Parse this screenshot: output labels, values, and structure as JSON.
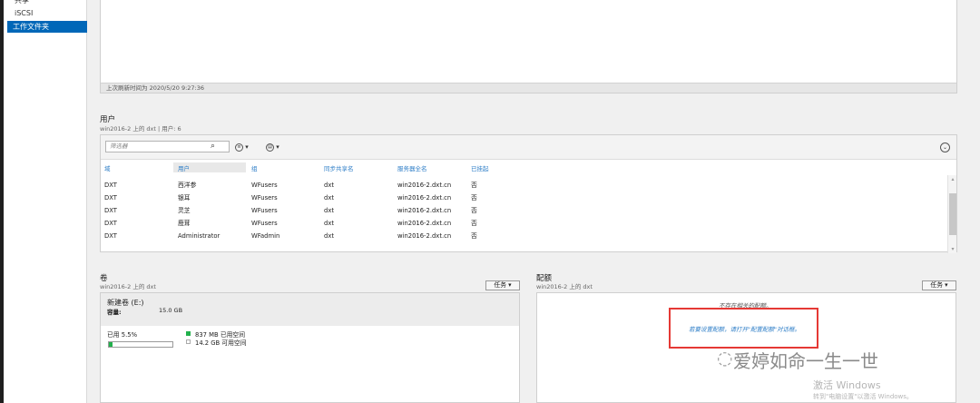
{
  "nav": {
    "items": [
      {
        "label": "共享"
      },
      {
        "label": "iSCSI"
      },
      {
        "label": "工作文件夹"
      }
    ]
  },
  "top_panel": {
    "last_refresh": "上次刷新时间为 2020/5/20 9:27:36"
  },
  "users": {
    "title": "用户",
    "subtitle": "win2016-2 上的 dxt | 用户: 6",
    "filter_placeholder": "筛选器",
    "columns": [
      "域",
      "用户",
      "组",
      "同步共享名",
      "服务器全名",
      "已挂起"
    ],
    "rows": [
      [
        "DXT",
        "西洋参",
        "WFusers",
        "dxt",
        "win2016-2.dxt.cn",
        "否"
      ],
      [
        "DXT",
        "银耳",
        "WFusers",
        "dxt",
        "win2016-2.dxt.cn",
        "否"
      ],
      [
        "DXT",
        "灵芝",
        "WFusers",
        "dxt",
        "win2016-2.dxt.cn",
        "否"
      ],
      [
        "DXT",
        "鹿茸",
        "WFusers",
        "dxt",
        "win2016-2.dxt.cn",
        "否"
      ],
      [
        "DXT",
        "Administrator",
        "WFadmin",
        "dxt",
        "win2016-2.dxt.cn",
        "否"
      ]
    ]
  },
  "volume": {
    "title": "卷",
    "subtitle": "win2016-2 上的 dxt",
    "task_label": "任务",
    "name": "新建卷 (E:)",
    "capacity_label": "容量:",
    "capacity_value": "15.0 GB",
    "used_label": "已用 5.5%",
    "used_fraction": 0.055,
    "used_space": "837 MB 已用空间",
    "free_space": "14.2 GB 可用空间",
    "used_color": "#22b14c"
  },
  "quota": {
    "title": "配额",
    "subtitle": "win2016-2 上的 dxt",
    "task_label": "任务",
    "no_quota": "不存在相关的配额。",
    "hint": "若要设置配额，请打开\"配置配额\"对话框。"
  },
  "watermark": {
    "brand": "爱婷如命一生一世",
    "activate_title": "激活 Windows",
    "activate_sub": "转到\"电脑设置\"以激活 Windows。"
  },
  "colors": {
    "accent": "#0067b8",
    "link": "#2e7ec7",
    "highlight_box": "#e53935"
  }
}
